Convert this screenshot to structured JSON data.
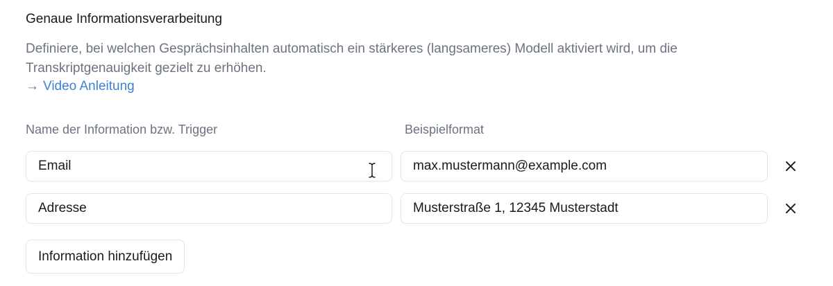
{
  "section": {
    "title": "Genaue Informationsverarbeitung",
    "description": "Definiere, bei welchen Gesprächsinhalten automatisch ein stärkeres (langsameres) Modell aktiviert wird, um die Transkriptgenauigkeit gezielt zu erhöhen.",
    "video_link": {
      "arrow": "→",
      "label": "Video Anleitung"
    }
  },
  "table": {
    "headers": {
      "name": "Name der Information bzw. Trigger",
      "format": "Beispielformat"
    },
    "rows": [
      {
        "name": "Email",
        "format": "max.mustermann@example.com"
      },
      {
        "name": "Adresse",
        "format": "Musterstraße 1, 12345 Musterstadt"
      }
    ]
  },
  "actions": {
    "add_label": "Information hinzufügen"
  },
  "icons": {
    "remove": "close-icon",
    "cursor": "text-cursor-icon"
  },
  "colors": {
    "link": "#3b82d6",
    "muted_text": "#6b7280",
    "border": "#e3e5e8"
  }
}
